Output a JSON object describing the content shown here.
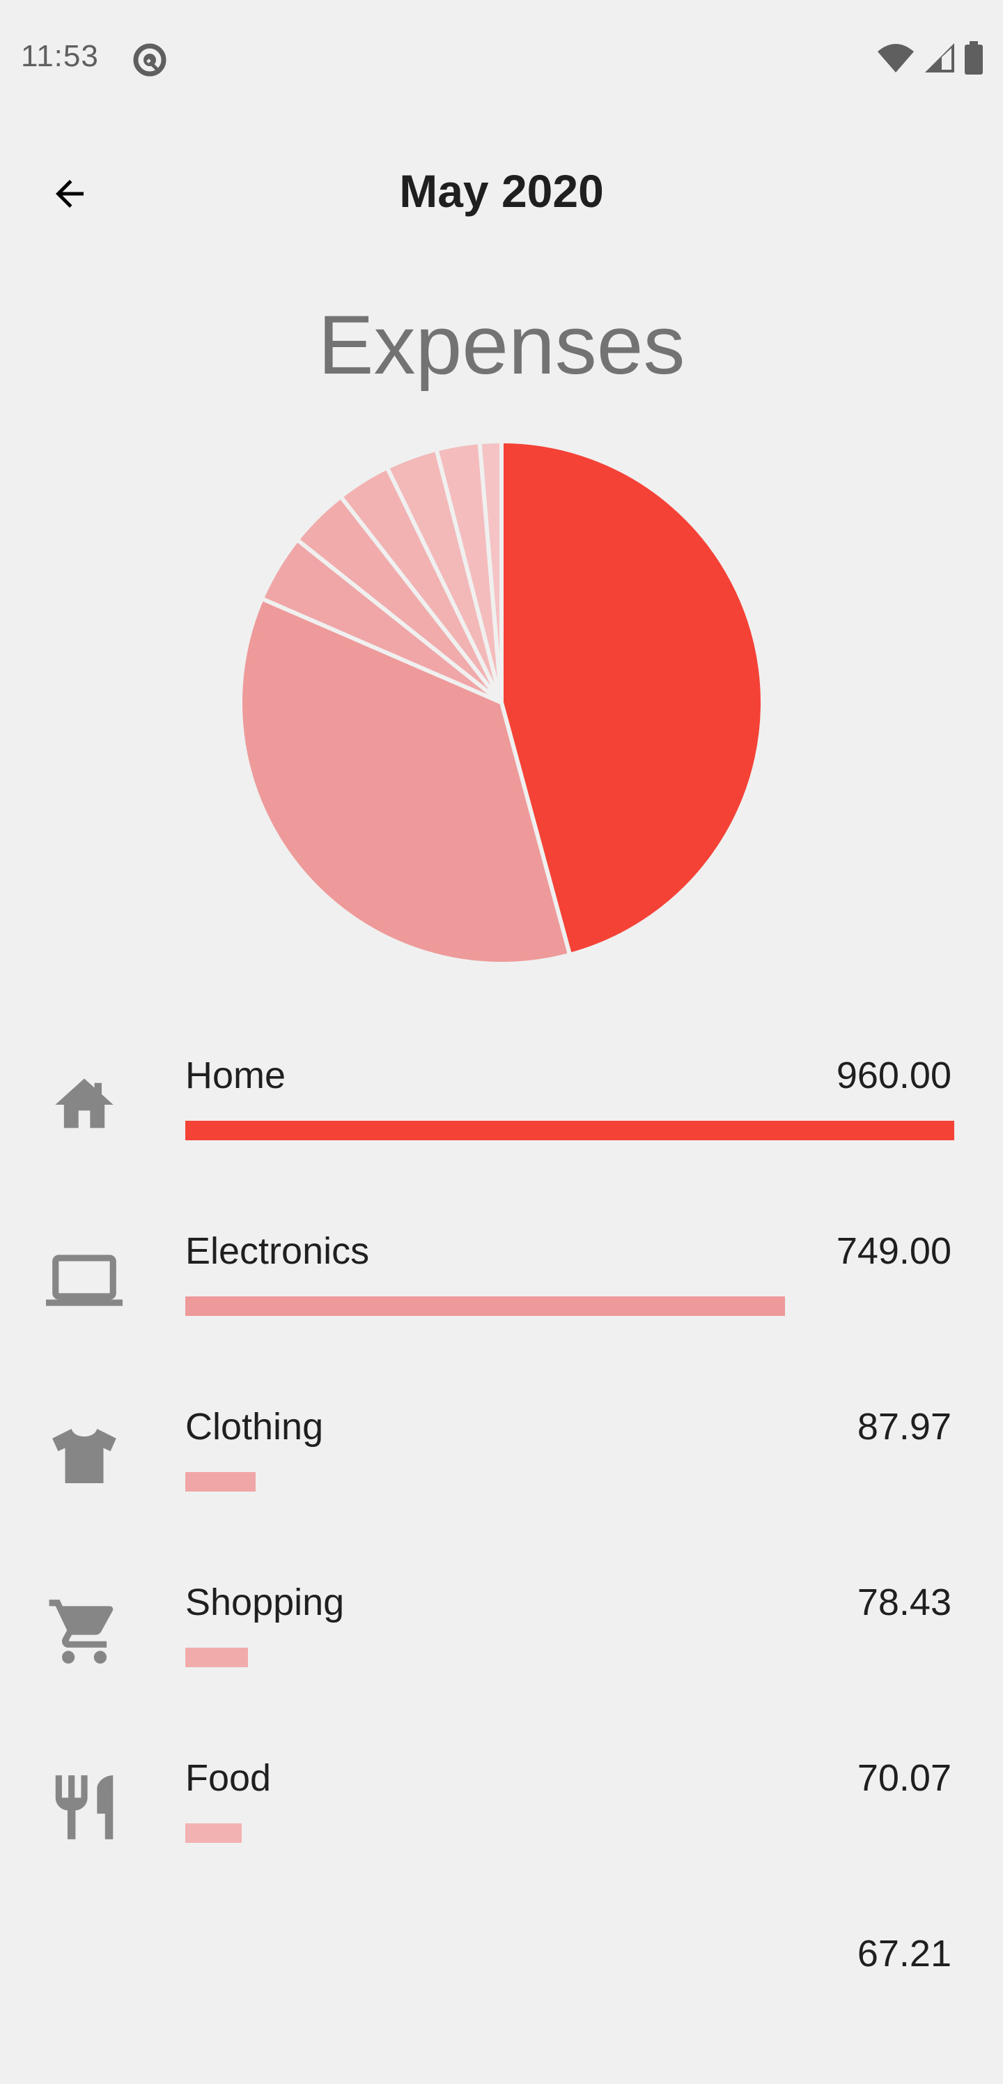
{
  "status_bar": {
    "time": "11:53",
    "icons": [
      "android-q-icon",
      "wifi-icon",
      "cellular-signal-icon",
      "battery-icon"
    ]
  },
  "app_bar": {
    "back_icon": "arrow-back-icon",
    "title": "May 2020"
  },
  "section_title": "Expenses",
  "colors": {
    "background": "#f0f0f0",
    "accent": "#f44336",
    "slice_2": "#ee9a9a",
    "slice_3": "#f0a6a6",
    "slice_4": "#f1abab",
    "slice_5": "#f2b2b2",
    "slice_6": "#f3b8b8",
    "slice_7": "#f4bcbc",
    "slice_8": "#f5c3c3",
    "icon": "#868686",
    "text": "#1f1f1f"
  },
  "categories": [
    {
      "label": "Home",
      "value": "960.00",
      "amount": 960.0,
      "icon": "home-icon"
    },
    {
      "label": "Electronics",
      "value": "749.00",
      "amount": 749.0,
      "icon": "laptop-icon"
    },
    {
      "label": "Clothing",
      "value": "87.97",
      "amount": 87.97,
      "icon": "tshirt-icon"
    },
    {
      "label": "Shopping",
      "value": "78.43",
      "amount": 78.43,
      "icon": "shopping-cart-icon"
    },
    {
      "label": "Food",
      "value": "70.07",
      "amount": 70.07,
      "icon": "restaurant-icon"
    },
    {
      "label": "",
      "value": "67.21",
      "amount": 67.21,
      "icon": ""
    }
  ],
  "chart_data": {
    "type": "pie",
    "title": "Expenses",
    "start_angle": "12 o'clock",
    "direction": "clockwise",
    "labels": [
      "Home",
      "Electronics",
      "Clothing",
      "Shopping",
      "Food",
      "(cut off)",
      "(unlabeled)",
      "(unlabeled)"
    ],
    "values": [
      960.0,
      749.0,
      87.97,
      78.43,
      70.07,
      67.21,
      56,
      28
    ]
  }
}
